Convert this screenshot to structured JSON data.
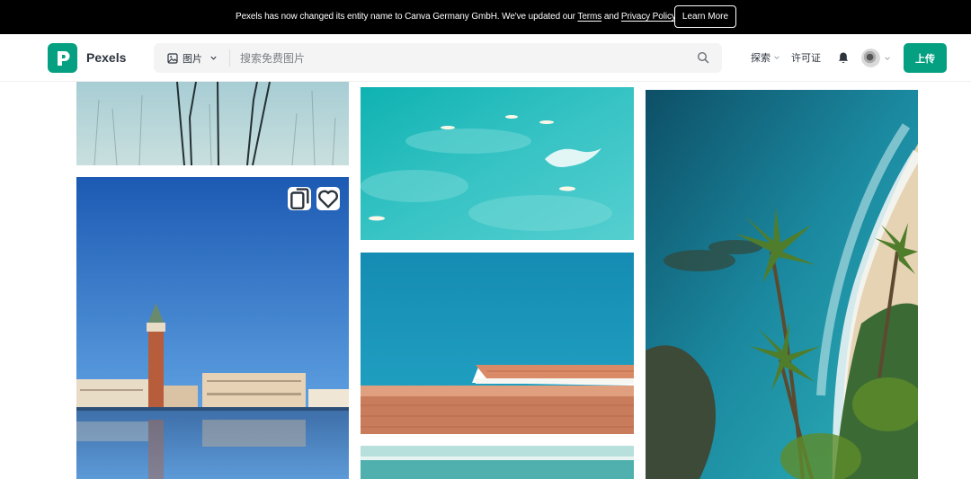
{
  "banner": {
    "text_before": "Pexels has now changed its entity name to Canva Germany GmbH. We've updated our ",
    "terms_link": "Terms",
    "text_and": " and ",
    "privacy_link": "Privacy Policy",
    "text_after": ".",
    "learn_more": "Learn More"
  },
  "header": {
    "brand": "Pexels",
    "logo_letter": "P",
    "search_type": "图片",
    "search_placeholder": "搜索免费图片",
    "nav_explore": "探索",
    "nav_license": "许可证",
    "upload": "上传"
  },
  "colors": {
    "brand_green": "#05a081",
    "banner_bg": "#000000"
  },
  "icons": {
    "search_type": "image-icon",
    "search": "search-icon",
    "notifications": "bell-icon",
    "collect": "collection-icon",
    "like": "heart-icon"
  }
}
